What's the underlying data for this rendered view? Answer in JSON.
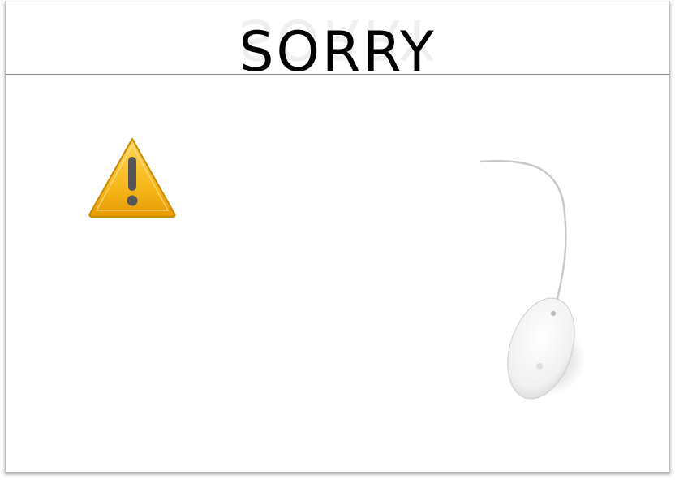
{
  "header": {
    "title": "SORRY"
  },
  "icons": {
    "warning": "warning-icon",
    "mouse": "mouse-icon"
  },
  "colors": {
    "warning_fill": "#f7b81a",
    "warning_edge": "#c88a05",
    "exclamation": "#555555"
  }
}
